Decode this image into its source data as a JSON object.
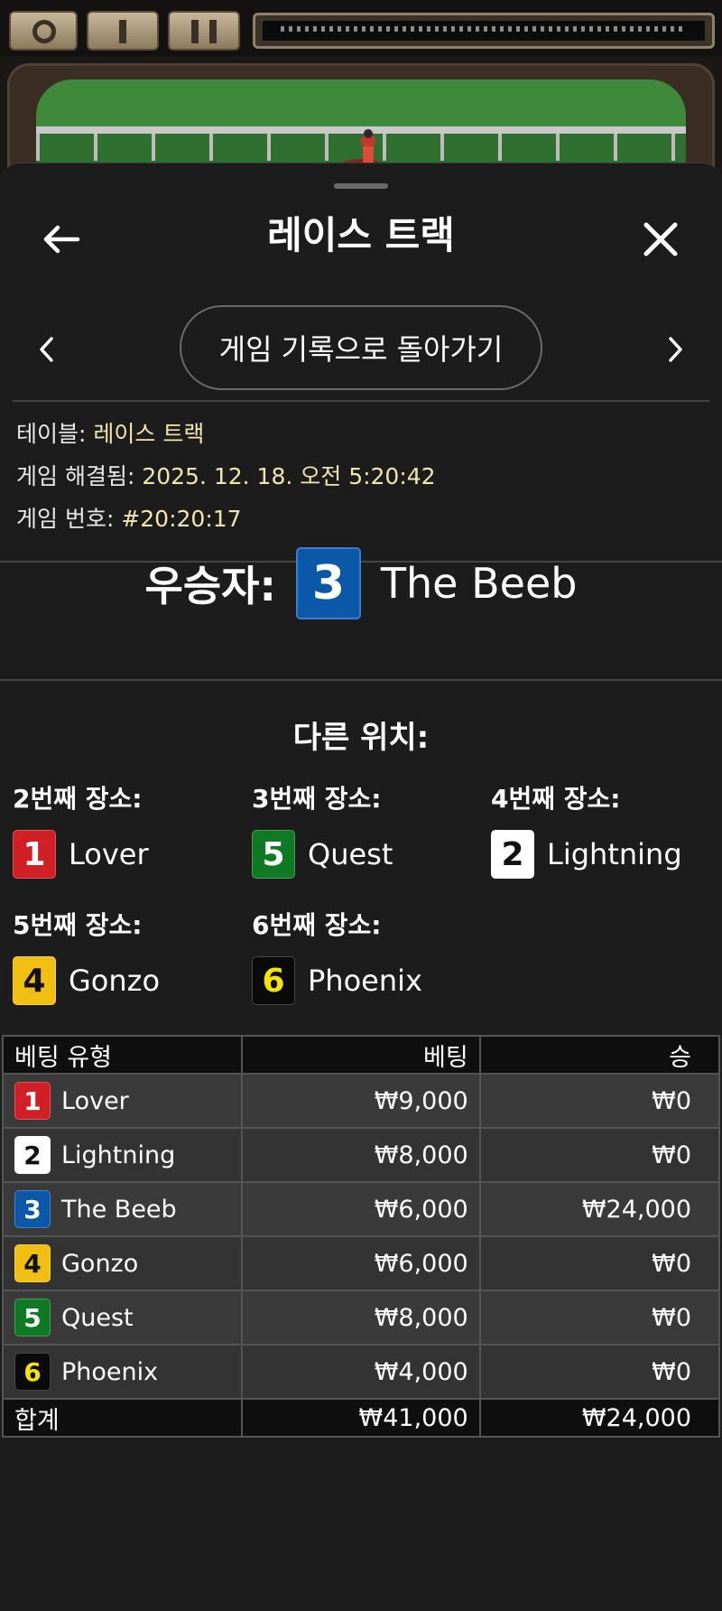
{
  "game_topbar": {
    "ticker_label": "game-ticker"
  },
  "header": {
    "title": "레이스 트랙",
    "back_icon": "arrow-left-icon",
    "close_icon": "close-icon"
  },
  "nav": {
    "history_button_label": "게임 기록으로 돌아가기",
    "prev_icon": "chevron-left-icon",
    "next_icon": "chevron-right-icon"
  },
  "info": {
    "table_label": "테이블: ",
    "table_value": "레이스 트랙",
    "resolved_label": "게임 해결됨: ",
    "resolved_value": "2025. 12. 18. 오전 5:20:42",
    "game_number_label": "게임 번호: ",
    "game_number_value": "#20:20:17"
  },
  "winner": {
    "label": "우승자:",
    "number": "3",
    "name": "The Beeb",
    "color": "#0b57a8",
    "text_color": "#ffffff"
  },
  "other_positions": {
    "title": "다른 위치:",
    "places": [
      {
        "label": "2번째 장소:",
        "number": "1",
        "name": "Lover",
        "color": "#d01f25",
        "text_color": "#ffffff"
      },
      {
        "label": "3번째 장소:",
        "number": "5",
        "name": "Quest",
        "color": "#0f7a23",
        "text_color": "#ffffff"
      },
      {
        "label": "4번째 장소:",
        "number": "2",
        "name": "Lightning",
        "color": "#ffffff",
        "text_color": "#111111"
      },
      {
        "label": "5번째 장소:",
        "number": "4",
        "name": "Gonzo",
        "color": "#f1be12",
        "text_color": "#111111"
      },
      {
        "label": "6번째 장소:",
        "number": "6",
        "name": "Phoenix",
        "color": "#0a0a0a",
        "text_color": "#f5e400"
      }
    ]
  },
  "bets_table": {
    "headers": {
      "type": "베팅 유형",
      "bet": "베팅",
      "win": "승"
    },
    "rows": [
      {
        "number": "1",
        "name": "Lover",
        "bet": "₩9,000",
        "win": "₩0",
        "color": "#d01f25",
        "text_color": "#ffffff"
      },
      {
        "number": "2",
        "name": "Lightning",
        "bet": "₩8,000",
        "win": "₩0",
        "color": "#ffffff",
        "text_color": "#111111"
      },
      {
        "number": "3",
        "name": "The Beeb",
        "bet": "₩6,000",
        "win": "₩24,000",
        "color": "#0b57a8",
        "text_color": "#ffffff"
      },
      {
        "number": "4",
        "name": "Gonzo",
        "bet": "₩6,000",
        "win": "₩0",
        "color": "#f1be12",
        "text_color": "#111111"
      },
      {
        "number": "5",
        "name": "Quest",
        "bet": "₩8,000",
        "win": "₩0",
        "color": "#0f7a23",
        "text_color": "#ffffff"
      },
      {
        "number": "6",
        "name": "Phoenix",
        "bet": "₩4,000",
        "win": "₩0",
        "color": "#0a0a0a",
        "text_color": "#f5e400"
      }
    ],
    "total": {
      "label": "합계",
      "bet": "₩41,000",
      "win": "₩24,000"
    }
  },
  "colors": {
    "info_value": "#f2e6ad",
    "sheet_background": "#1c1c1c"
  }
}
